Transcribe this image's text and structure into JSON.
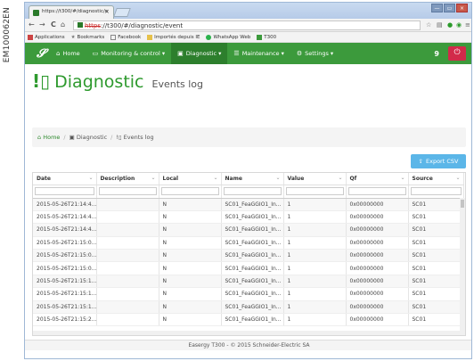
{
  "side_label": "EM100062EN",
  "browser": {
    "tab_title": "https://t300/#/diagnostic/e",
    "tab_close": "×",
    "window_controls": [
      "—",
      "▭",
      "×"
    ],
    "nav": {
      "back": "←",
      "forward": "→",
      "reload": "C",
      "home": "⌂"
    },
    "url_protocol": "https",
    "url_rest": "://t300/#/diagnostic/event",
    "bookmarks": [
      {
        "label": "Applications",
        "icon": "apps-icon"
      },
      {
        "label": "Bookmarks",
        "icon": "star-icon"
      },
      {
        "label": "Facebook",
        "icon": "page-icon"
      },
      {
        "label": "Importés depuis IE",
        "icon": "folder-icon"
      },
      {
        "label": "WhatsApp Web",
        "icon": "whatsapp-icon"
      },
      {
        "label": "T300",
        "icon": "t300-icon"
      }
    ]
  },
  "app": {
    "nav": [
      {
        "label": "Home",
        "icon": "home-icon",
        "active": false
      },
      {
        "label": "Monitoring & control ▾",
        "icon": "monitor-icon",
        "active": false
      },
      {
        "label": "Diagnostic ▾",
        "icon": "diagnostic-icon",
        "active": true
      },
      {
        "label": "Maintenance ▾",
        "icon": "wrench-icon",
        "active": false
      },
      {
        "label": "Settings ▾",
        "icon": "gear-icon",
        "active": false
      }
    ],
    "notification_count": "9",
    "page_title": "Diagnostic",
    "page_subtitle": "Events log",
    "breadcrumb": [
      "Home",
      "Diagnostic",
      "Events log"
    ],
    "export_label": "Export CSV",
    "columns": [
      "Date",
      "Description",
      "Local",
      "Name",
      "Value",
      "Qf",
      "Source"
    ],
    "rows": [
      [
        "2015-05-26T21:14:4...",
        "",
        "N",
        "SC01_FeaGGIO1_In...",
        "1",
        "0x00000000",
        "SC01"
      ],
      [
        "2015-05-26T21:14:4...",
        "",
        "N",
        "SC01_FeaGGIO1_In...",
        "1",
        "0x00000000",
        "SC01"
      ],
      [
        "2015-05-26T21:14:4...",
        "",
        "N",
        "SC01_FeaGGIO1_In...",
        "1",
        "0x00000000",
        "SC01"
      ],
      [
        "2015-05-26T21:15:0...",
        "",
        "N",
        "SC01_FeaGGIO1_In...",
        "1",
        "0x00000000",
        "SC01"
      ],
      [
        "2015-05-26T21:15:0...",
        "",
        "N",
        "SC01_FeaGGIO1_In...",
        "1",
        "0x00000000",
        "SC01"
      ],
      [
        "2015-05-26T21:15:0...",
        "",
        "N",
        "SC01_FeaGGIO1_In...",
        "1",
        "0x00000000",
        "SC01"
      ],
      [
        "2015-05-26T21:15:1...",
        "",
        "N",
        "SC01_FeaGGIO1_In...",
        "1",
        "0x00000000",
        "SC01"
      ],
      [
        "2015-05-26T21:15:1...",
        "",
        "N",
        "SC01_FeaGGIO1_In...",
        "1",
        "0x00000000",
        "SC01"
      ],
      [
        "2015-05-26T21:15:1...",
        "",
        "N",
        "SC01_FeaGGIO1_In...",
        "1",
        "0x00000000",
        "SC01"
      ],
      [
        "2015-05-26T21:15:2...",
        "",
        "N",
        "SC01_FeaGGIO1_In...",
        "1",
        "0x00000000",
        "SC01"
      ]
    ],
    "footer": "Easergy T300 - © 2015 Schneider-Electric SA",
    "colors": {
      "brand_green": "#3c9a3c",
      "active_nav": "#2d7f2d",
      "export_blue": "#5bb6e8",
      "logout_red": "#d22a4a"
    }
  }
}
